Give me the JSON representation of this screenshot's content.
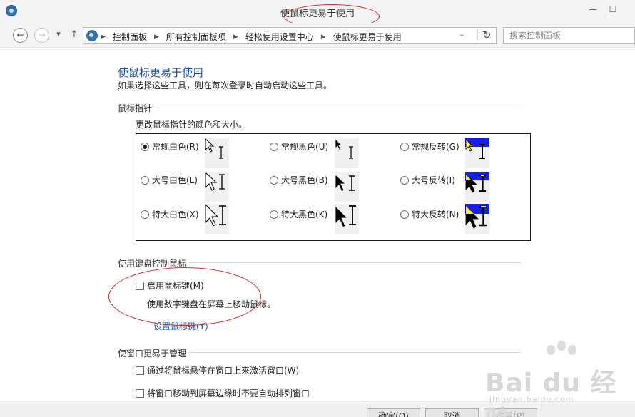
{
  "window": {
    "title": "使鼠标更易于使用",
    "minimize": "—",
    "maximize": "☐"
  },
  "nav": {
    "back": "←",
    "forward": "→",
    "recent": "▾",
    "up": "↑",
    "breadcrumbs": [
      "控制面板",
      "所有控制面板项",
      "轻松使用设置中心",
      "使鼠标更易于使用"
    ],
    "crumb_separator": "▶",
    "dropdown": "⌄",
    "refresh": "↻",
    "search_placeholder": "搜索控制面板"
  },
  "page": {
    "title": "使鼠标更易于使用",
    "description": "如果选择这些工具，则在每次登录时自动启动这些工具。"
  },
  "pointers": {
    "section_title": "鼠标指针",
    "subtitle": "更改鼠标指针的颜色和大小。",
    "options": [
      {
        "label": "常规白色(R)",
        "selected": true,
        "scheme": "white",
        "size": "regular"
      },
      {
        "label": "常规黑色(U)",
        "selected": false,
        "scheme": "black",
        "size": "regular"
      },
      {
        "label": "常规反转(G)",
        "selected": false,
        "scheme": "inverted",
        "size": "regular"
      },
      {
        "label": "大号白色(L)",
        "selected": false,
        "scheme": "white",
        "size": "large"
      },
      {
        "label": "大号黑色(B)",
        "selected": false,
        "scheme": "black",
        "size": "large"
      },
      {
        "label": "大号反转(I)",
        "selected": false,
        "scheme": "inverted",
        "size": "large"
      },
      {
        "label": "特大白色(X)",
        "selected": false,
        "scheme": "white",
        "size": "xlarge"
      },
      {
        "label": "特大黑色(K)",
        "selected": false,
        "scheme": "black",
        "size": "xlarge"
      },
      {
        "label": "特大反转(N)",
        "selected": false,
        "scheme": "inverted",
        "size": "xlarge"
      }
    ]
  },
  "keyboard": {
    "section_title": "使用键盘控制鼠标",
    "mouse_keys_label": "启用鼠标键(M)",
    "mouse_keys_checked": false,
    "mouse_keys_desc": "使用数字键盘在屏幕上移动鼠标。",
    "setup_link": "设置鼠标键(Y)"
  },
  "window_mgmt": {
    "section_title": "使窗口更易于管理",
    "hover_activate_label": "通过将鼠标悬停在窗口上来激活窗口(W)",
    "hover_activate_checked": false,
    "snap_label": "将窗口移动到屏幕边缘时不要自动排列窗口",
    "snap_checked": false
  },
  "buttons": {
    "ok": "确定(O)",
    "cancel": "取消",
    "apply": "应用(P)"
  },
  "watermark": {
    "brand": "Bai du 经验",
    "url": "jingyan.baidu.com"
  },
  "colors": {
    "accent_title": "#1e4e97",
    "link": "#1e5fb4",
    "annotation": "#d8282c",
    "inverted_bg": "#1420e8",
    "inverted_fg": "#ffee22"
  }
}
